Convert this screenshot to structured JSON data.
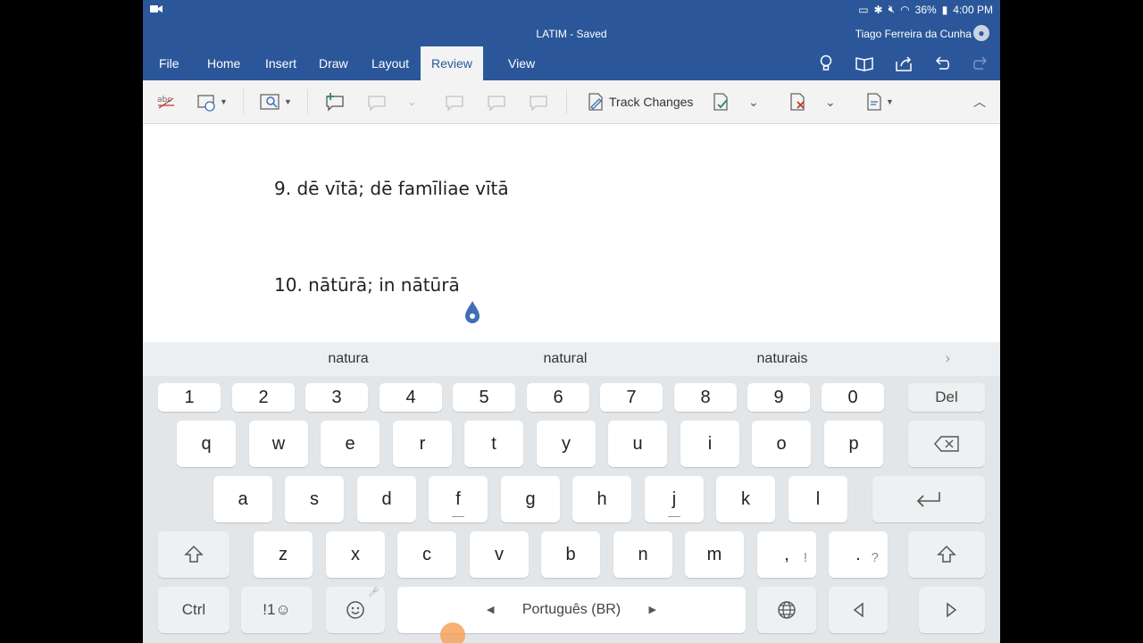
{
  "status": {
    "battery": "36%",
    "time": "4:00 PM"
  },
  "title": {
    "doc": "LATIM - Saved",
    "user": "Tiago Ferreira da Cunha"
  },
  "tabs": [
    "File",
    "Home",
    "Insert",
    "Draw",
    "Layout",
    "Review",
    "View"
  ],
  "active_tab": "Review",
  "ribbon": {
    "track_changes": "Track Changes"
  },
  "document": {
    "line1": "9. dē vītā; dē famīliae vītā",
    "line2": "10. nātūrā; in nātūrā"
  },
  "suggestions": [
    "natura",
    "natural",
    "naturais"
  ],
  "keyboard": {
    "row1": [
      "1",
      "2",
      "3",
      "4",
      "5",
      "6",
      "7",
      "8",
      "9",
      "0"
    ],
    "del": "Del",
    "row2": [
      "q",
      "w",
      "e",
      "r",
      "t",
      "y",
      "u",
      "i",
      "o",
      "p"
    ],
    "row3": [
      "a",
      "s",
      "d",
      "f",
      "g",
      "h",
      "j",
      "k",
      "l"
    ],
    "row4": [
      "z",
      "x",
      "c",
      "v",
      "b",
      "n",
      "m"
    ],
    "comma": ",",
    "comma_alt": "!",
    "period": ".",
    "period_alt": "?",
    "ctrl": "Ctrl",
    "sym": "!1☺",
    "space_lang": "Português (BR)"
  },
  "colors": {
    "accent": "#2b579a",
    "ribbon": "#f3f3f3",
    "keyboard": "#e3e6e9"
  }
}
